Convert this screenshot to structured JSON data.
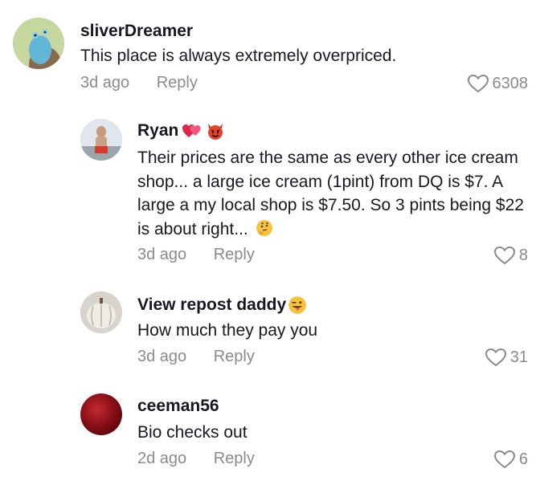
{
  "comments": [
    {
      "username": "sliverDreamer",
      "text": "This place is always extremely overpriced.",
      "time": "3d ago",
      "reply_label": "Reply",
      "likes": "6308"
    },
    {
      "username": "Ryan",
      "text": "Their prices are the same as every other ice cream shop... a large ice cream (1pint) from DQ is $7. A large a my local shop is $7.50. So 3 pints being $22 is about right...",
      "time": "3d ago",
      "reply_label": "Reply",
      "likes": "8"
    },
    {
      "username": "View repost daddy",
      "text": "How much they pay you",
      "time": "3d ago",
      "reply_label": "Reply",
      "likes": "31"
    },
    {
      "username": "ceeman56",
      "text": "Bio checks out",
      "time": "2d ago",
      "reply_label": "Reply",
      "likes": "6"
    }
  ],
  "colors": {
    "text": "#161823",
    "secondary": "#8a8b91"
  }
}
